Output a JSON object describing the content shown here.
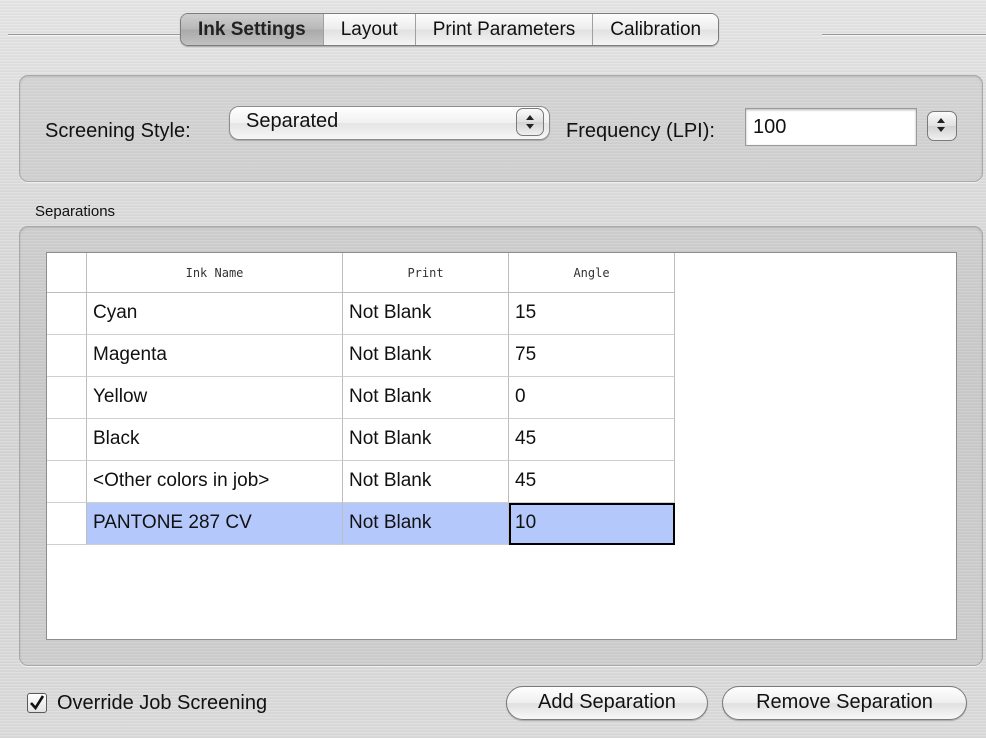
{
  "tabs": [
    {
      "label": "Ink Settings",
      "active": true
    },
    {
      "label": "Layout",
      "active": false
    },
    {
      "label": "Print Parameters",
      "active": false
    },
    {
      "label": "Calibration",
      "active": false
    }
  ],
  "screening": {
    "style_label": "Screening Style:",
    "style_value": "Separated",
    "frequency_label": "Frequency (LPI):",
    "frequency_value": "100"
  },
  "separations": {
    "title": "Separations",
    "columns": [
      "Ink Name",
      "Print",
      "Angle"
    ],
    "rows": [
      {
        "name": "Cyan",
        "print": "Not Blank",
        "angle": "15",
        "selected": false
      },
      {
        "name": "Magenta",
        "print": "Not Blank",
        "angle": "75",
        "selected": false
      },
      {
        "name": "Yellow",
        "print": "Not Blank",
        "angle": "0",
        "selected": false
      },
      {
        "name": "Black",
        "print": "Not Blank",
        "angle": "45",
        "selected": false
      },
      {
        "name": "<Other colors in job>",
        "print": "Not Blank",
        "angle": "45",
        "selected": false
      },
      {
        "name": "PANTONE 287 CV",
        "print": "Not Blank",
        "angle": "10",
        "selected": true
      }
    ]
  },
  "footer": {
    "override_label": "Override Job Screening",
    "override_checked": true,
    "add_label": "Add Separation",
    "remove_label": "Remove Separation"
  },
  "colors": {
    "selection": "#b5c8fb",
    "accent_tab": "#b7b7b7"
  }
}
